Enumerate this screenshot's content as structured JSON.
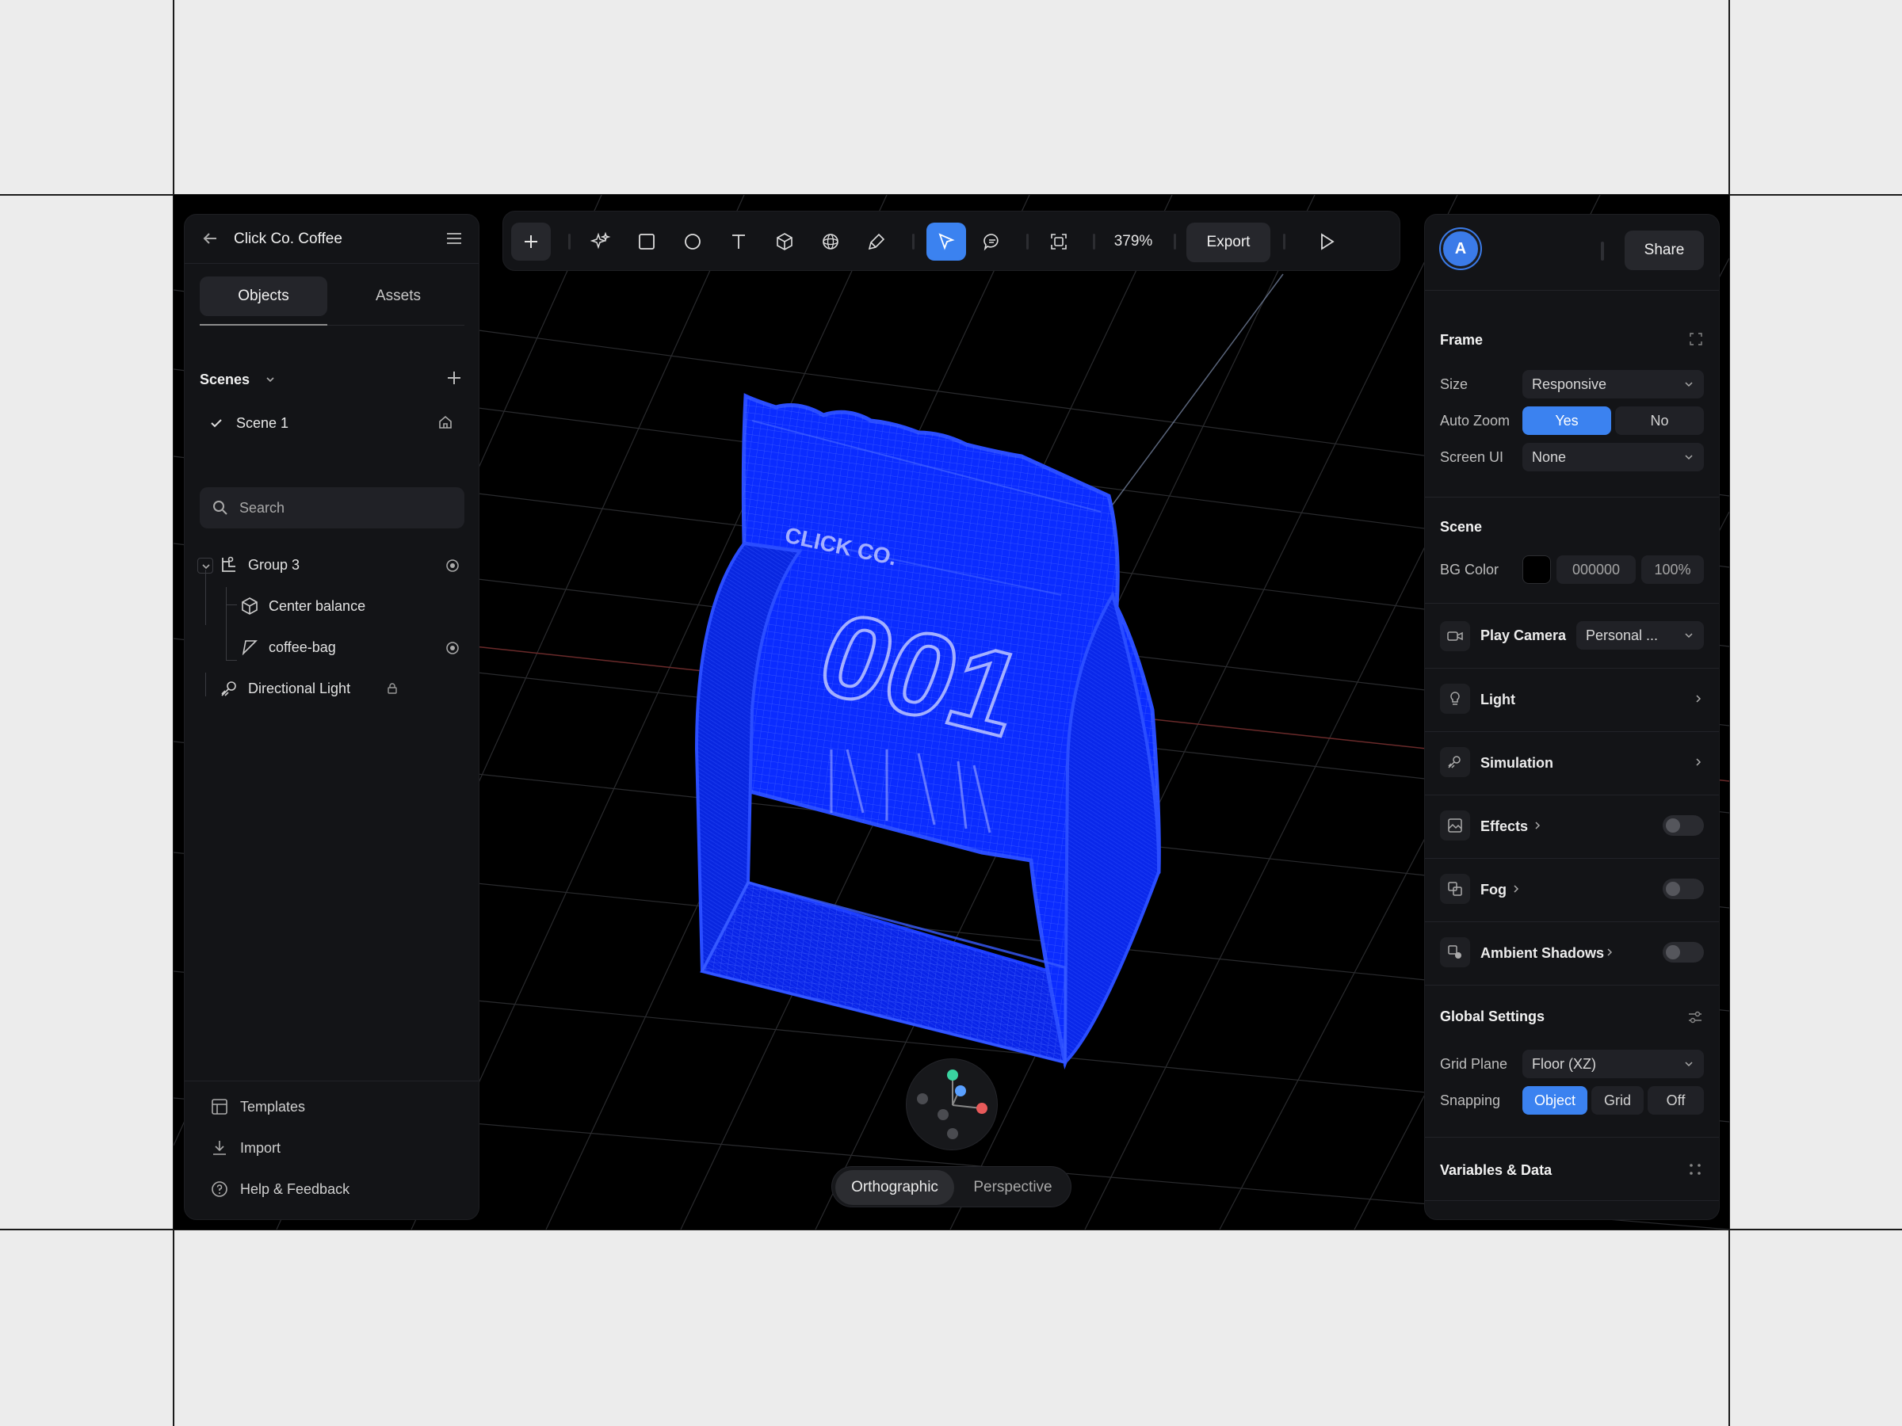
{
  "project": {
    "title": "Click Co. Coffee"
  },
  "left_panel": {
    "tabs": [
      "Objects",
      "Assets"
    ],
    "scenes_label": "Scenes",
    "scenes": [
      {
        "name": "Scene 1",
        "selected": true
      }
    ],
    "search_placeholder": "Search",
    "tree": [
      {
        "label": "Group 3",
        "icon": "group-icon",
        "visible": true
      },
      {
        "label": "Center balance",
        "icon": "cube-icon"
      },
      {
        "label": "coffee-bag",
        "icon": "mesh-icon",
        "visible": true
      },
      {
        "label": "Directional Light",
        "icon": "light-icon",
        "locked": true
      }
    ],
    "footer": [
      "Templates",
      "Import",
      "Help & Feedback"
    ]
  },
  "toolbar": {
    "tools": [
      "add-icon",
      "ai-sparkle-icon",
      "rectangle-icon",
      "ellipse-icon",
      "text-icon",
      "cube-icon",
      "sphere-icon",
      "pen-icon",
      "select-pointer-icon",
      "comment-icon",
      "frame-icon"
    ],
    "active_tool": "select-pointer-icon",
    "zoom": "379%",
    "export_label": "Export"
  },
  "viewport": {
    "bag_text_brand": "CLICK CO.",
    "bag_text_number": "001",
    "camera_modes": [
      "Orthographic",
      "Perspective"
    ],
    "active_camera": "Orthographic"
  },
  "right_panel": {
    "avatar_initial": "A",
    "share_label": "Share",
    "frame": {
      "title": "Frame",
      "size_label": "Size",
      "size_value": "Responsive",
      "auto_zoom_label": "Auto Zoom",
      "auto_zoom_options": [
        "Yes",
        "No"
      ],
      "auto_zoom_value": "Yes",
      "screen_ui_label": "Screen UI",
      "screen_ui_value": "None"
    },
    "scene": {
      "title": "Scene",
      "bg_color_label": "BG Color",
      "bg_color_hex": "000000",
      "bg_opacity": "100%",
      "play_camera_label": "Play Camera",
      "play_camera_value": "Personal ...",
      "light_label": "Light",
      "simulation_label": "Simulation",
      "effects_label": "Effects",
      "effects_on": false,
      "fog_label": "Fog",
      "fog_on": false,
      "ambient_shadows_label": "Ambient Shadows",
      "ambient_shadows_on": false
    },
    "global": {
      "title": "Global Settings",
      "grid_plane_label": "Grid Plane",
      "grid_plane_value": "Floor (XZ)",
      "snapping_label": "Snapping",
      "snapping_options": [
        "Object",
        "Grid",
        "Off"
      ],
      "snapping_value": "Object"
    },
    "variables_title": "Variables & Data"
  },
  "colors": {
    "accent": "#3b82f0",
    "bag": "#0b2cff",
    "panel": "#131417",
    "canvas": "#000000"
  }
}
